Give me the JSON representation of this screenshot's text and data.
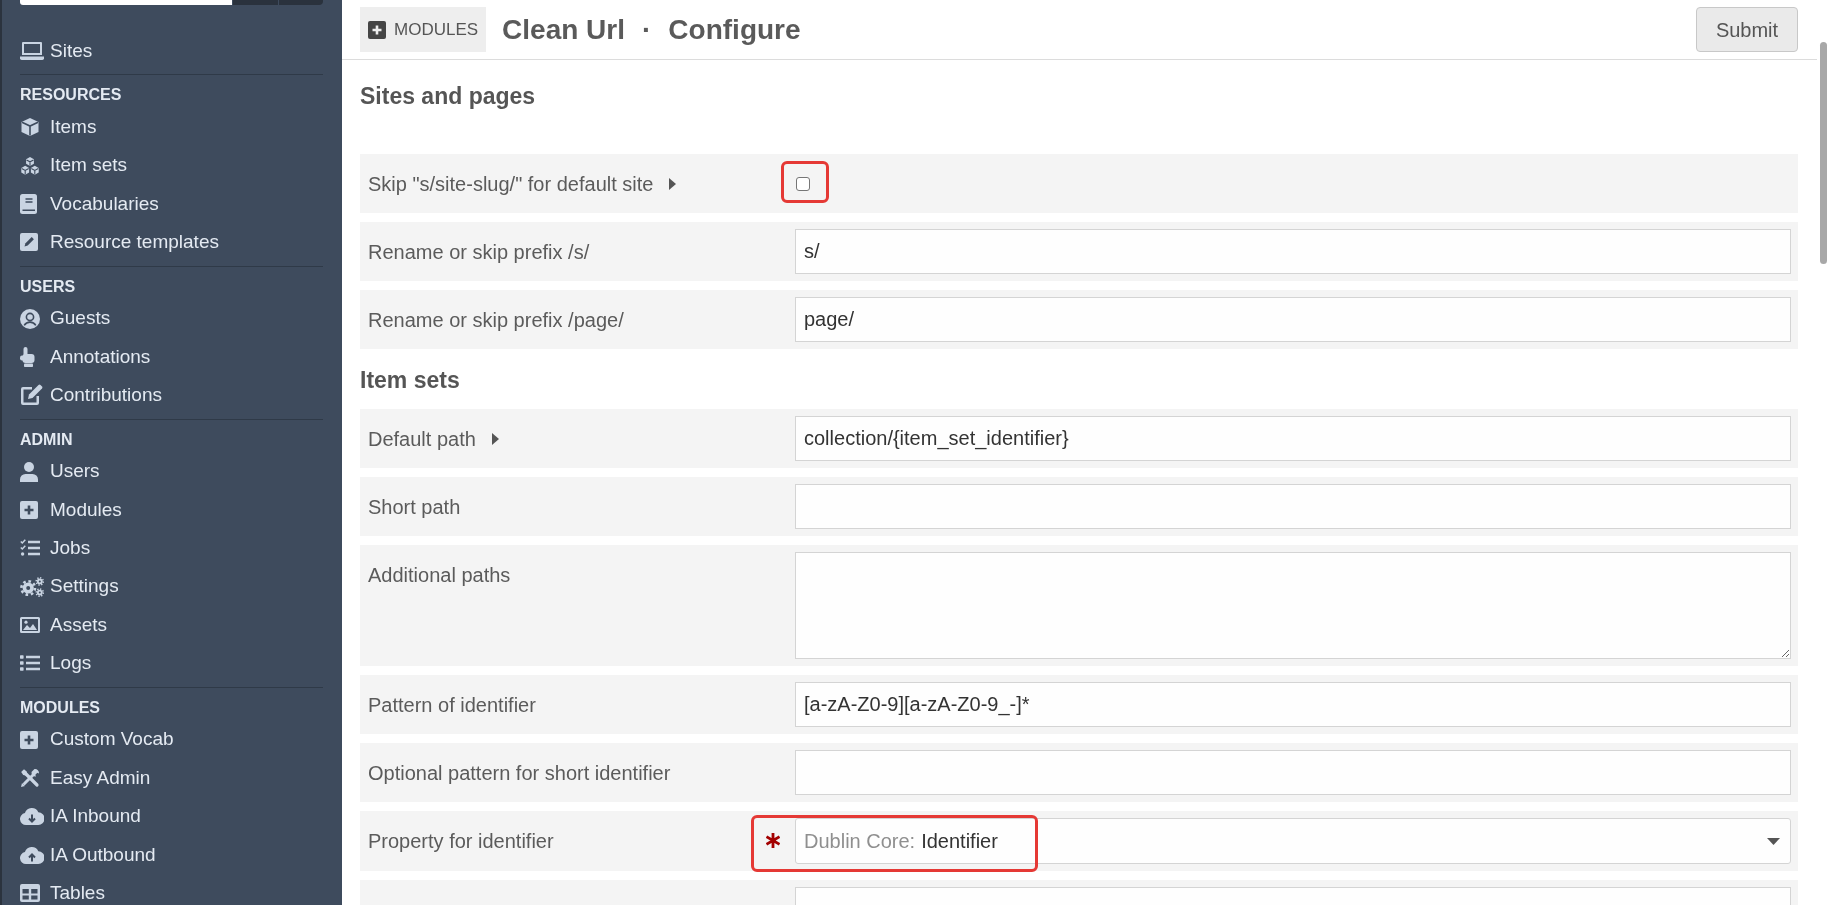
{
  "sidebar": {
    "top_items": [
      {
        "label": "Sites",
        "selected": false
      }
    ],
    "groups": [
      {
        "heading": "RESOURCES",
        "items": [
          {
            "label": "Items",
            "selected": false
          },
          {
            "label": "Item sets",
            "selected": false
          },
          {
            "label": "Vocabularies",
            "selected": false
          },
          {
            "label": "Resource templates",
            "selected": false
          }
        ]
      },
      {
        "heading": "USERS",
        "items": [
          {
            "label": "Guests",
            "selected": false
          },
          {
            "label": "Annotations",
            "selected": false
          },
          {
            "label": "Contributions",
            "selected": false
          }
        ]
      },
      {
        "heading": "ADMIN",
        "items": [
          {
            "label": "Users",
            "selected": false
          },
          {
            "label": "Modules",
            "selected": false
          },
          {
            "label": "Jobs",
            "selected": false
          },
          {
            "label": "Settings",
            "selected": false
          },
          {
            "label": "Assets",
            "selected": false
          },
          {
            "label": "Logs",
            "selected": false
          }
        ]
      },
      {
        "heading": "MODULES",
        "items": [
          {
            "label": "Custom Vocab",
            "selected": false
          },
          {
            "label": "Easy Admin",
            "selected": false
          },
          {
            "label": "IA Inbound",
            "selected": false
          },
          {
            "label": "IA Outbound",
            "selected": false
          },
          {
            "label": "Tables",
            "selected": false
          }
        ]
      }
    ]
  },
  "header": {
    "breadcrumb": "MODULES",
    "title": "Clean Url",
    "separator": "·",
    "subtitle": "Configure",
    "submit": "Submit"
  },
  "sections": [
    {
      "heading": "Sites and pages",
      "rows": [
        {
          "kind": "checkbox",
          "label": "Skip \"s/site-slug/\" for default site",
          "details": {
            "expanded": false
          },
          "checked": false,
          "required": false,
          "highlighted": true
        },
        {
          "kind": "text",
          "label": "Rename or skip prefix /s/",
          "value": "s/",
          "required": false,
          "highlighted": false
        },
        {
          "kind": "text",
          "label": "Rename or skip prefix /page/",
          "value": "page/",
          "required": false,
          "highlighted": false
        }
      ]
    },
    {
      "heading": "Item sets",
      "rows": [
        {
          "kind": "text",
          "label": "Default path",
          "details": {
            "expanded": false
          },
          "value": "collection/{item_set_identifier}",
          "required": false,
          "highlighted": false
        },
        {
          "kind": "text",
          "label": "Short path",
          "required": false,
          "highlighted": false
        },
        {
          "kind": "textarea",
          "label": "Additional paths",
          "required": false,
          "highlighted": false
        },
        {
          "kind": "text",
          "label": "Pattern of identifier",
          "value": "[a-zA-Z0-9][a-zA-Z0-9_-]*",
          "required": false,
          "highlighted": false
        },
        {
          "kind": "text",
          "label": "Optional pattern for short identifier",
          "required": false,
          "highlighted": false
        },
        {
          "kind": "select",
          "label": "Property for identifier",
          "group": "Dublin Core:",
          "value": "Identifier",
          "required": true,
          "highlighted": true
        },
        {
          "kind": "text",
          "required": false,
          "highlighted": false
        }
      ]
    }
  ]
}
